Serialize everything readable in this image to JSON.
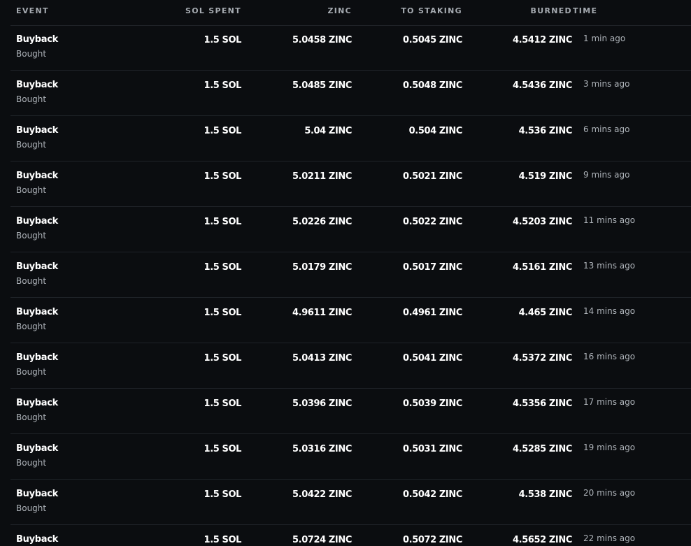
{
  "headers": {
    "event": "EVENT",
    "sol_spent": "SOL SPENT",
    "zinc": "ZINC",
    "to_staking": "TO STAKING",
    "burned": "BURNED",
    "time": "TIME"
  },
  "rows": [
    {
      "event": "Buyback",
      "sub": "Bought",
      "sol": "1.5 SOL",
      "zinc": "5.0458 ZINC",
      "staking": "0.5045 ZINC",
      "burned": "4.5412 ZINC",
      "time": "1 min ago"
    },
    {
      "event": "Buyback",
      "sub": "Bought",
      "sol": "1.5 SOL",
      "zinc": "5.0485 ZINC",
      "staking": "0.5048 ZINC",
      "burned": "4.5436 ZINC",
      "time": "3 mins ago"
    },
    {
      "event": "Buyback",
      "sub": "Bought",
      "sol": "1.5 SOL",
      "zinc": "5.04 ZINC",
      "staking": "0.504 ZINC",
      "burned": "4.536 ZINC",
      "time": "6 mins ago"
    },
    {
      "event": "Buyback",
      "sub": "Bought",
      "sol": "1.5 SOL",
      "zinc": "5.0211 ZINC",
      "staking": "0.5021 ZINC",
      "burned": "4.519 ZINC",
      "time": "9 mins ago"
    },
    {
      "event": "Buyback",
      "sub": "Bought",
      "sol": "1.5 SOL",
      "zinc": "5.0226 ZINC",
      "staking": "0.5022 ZINC",
      "burned": "4.5203 ZINC",
      "time": "11 mins ago"
    },
    {
      "event": "Buyback",
      "sub": "Bought",
      "sol": "1.5 SOL",
      "zinc": "5.0179 ZINC",
      "staking": "0.5017 ZINC",
      "burned": "4.5161 ZINC",
      "time": "13 mins ago"
    },
    {
      "event": "Buyback",
      "sub": "Bought",
      "sol": "1.5 SOL",
      "zinc": "4.9611 ZINC",
      "staking": "0.4961 ZINC",
      "burned": "4.465 ZINC",
      "time": "14 mins ago"
    },
    {
      "event": "Buyback",
      "sub": "Bought",
      "sol": "1.5 SOL",
      "zinc": "5.0413 ZINC",
      "staking": "0.5041 ZINC",
      "burned": "4.5372 ZINC",
      "time": "16 mins ago"
    },
    {
      "event": "Buyback",
      "sub": "Bought",
      "sol": "1.5 SOL",
      "zinc": "5.0396 ZINC",
      "staking": "0.5039 ZINC",
      "burned": "4.5356 ZINC",
      "time": "17 mins ago"
    },
    {
      "event": "Buyback",
      "sub": "Bought",
      "sol": "1.5 SOL",
      "zinc": "5.0316 ZINC",
      "staking": "0.5031 ZINC",
      "burned": "4.5285 ZINC",
      "time": "19 mins ago"
    },
    {
      "event": "Buyback",
      "sub": "Bought",
      "sol": "1.5 SOL",
      "zinc": "5.0422 ZINC",
      "staking": "0.5042 ZINC",
      "burned": "4.538 ZINC",
      "time": "20 mins ago"
    },
    {
      "event": "Buyback",
      "sub": "",
      "sol": "1.5 SOL",
      "zinc": "5.0724 ZINC",
      "staking": "0.5072 ZINC",
      "burned": "4.5652 ZINC",
      "time": "22 mins ago"
    }
  ]
}
